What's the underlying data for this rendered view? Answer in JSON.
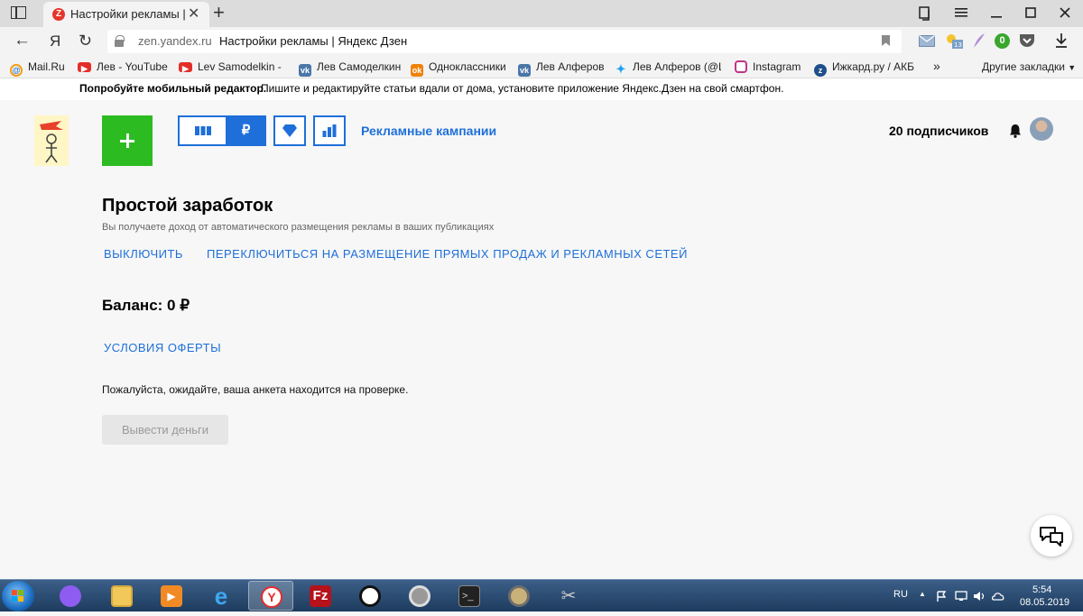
{
  "browser": {
    "tab_title": "Настройки рекламы | Я",
    "url_host": "zen.yandex.ru",
    "url_title": "Настройки рекламы | Яндекс Дзен",
    "yandex_letter": "Я",
    "ext_badge": "0"
  },
  "bookmarks": [
    {
      "label": "Mail.Ru",
      "icon_color": "#1a66c4"
    },
    {
      "label": "Лев - YouTube",
      "icon_color": "#e52d27"
    },
    {
      "label": "Lev Samodelkin - Y",
      "icon_color": "#e52d27"
    },
    {
      "label": "Лев Самоделкин",
      "icon_color": "#4a76a8"
    },
    {
      "label": "Одноклассники",
      "icon_color": "#ee8208"
    },
    {
      "label": "Лев Алферов",
      "icon_color": "#4a76a8"
    },
    {
      "label": "Лев Алферов (@Le",
      "icon_color": "#1da1f2"
    },
    {
      "label": "Instagram",
      "icon_color": "#c13584"
    },
    {
      "label": "Ижкард.ру / АКБ",
      "icon_color": "#1f4f8a"
    }
  ],
  "bookmarks_more": "»",
  "bookmarks_other": "Другие закладки",
  "banner": {
    "strong": "Попробуйте мобильный редактор.",
    "text": "Пишите и редактируйте статьи вдали от дома, установите приложение Яндекс.Дзен на свой смартфон."
  },
  "header": {
    "ruble": "₽",
    "campaigns_link": "Рекламные кампании",
    "subscribers": "20 подписчиков"
  },
  "main": {
    "title": "Простой заработок",
    "description": "Вы получаете доход от автоматического размещения рекламы в ваших публикациях",
    "disable_link": "ВЫКЛЮЧИТЬ",
    "switch_link": "ПЕРЕКЛЮЧИТЬСЯ НА РАЗМЕЩЕНИЕ ПРЯМЫХ ПРОДАЖ И РЕКЛАМНЫХ СЕТЕЙ",
    "balance": "Баланс: 0 ₽",
    "offer_link": "УСЛОВИЯ ОФЕРТЫ",
    "wait_message": "Пожалуйста, ожидайте, ваша анкета находится на проверке.",
    "withdraw_button": "Вывести деньги"
  },
  "taskbar": {
    "lang": "RU",
    "time": "5:54",
    "date": "08.05.2019"
  },
  "colors": {
    "accent": "#1e6fd9",
    "add_button": "#2dbb22",
    "disabled_text": "#9a9a9a"
  }
}
